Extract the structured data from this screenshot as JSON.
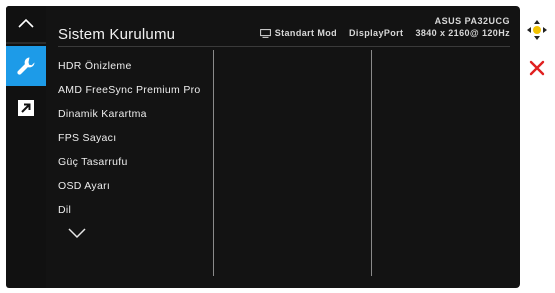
{
  "panel": {
    "title": "Sistem Kurulumu",
    "model": "ASUS PA32UCG",
    "mode": "Standart Mod",
    "input": "DisplayPort",
    "resolution": "3840 x 2160@  120Hz"
  },
  "menu": {
    "items": [
      "HDR Önizleme",
      "AMD FreeSync Premium Pro",
      "Dinamik Karartma",
      "FPS Sayacı",
      "Güç Tasarrufu",
      "OSD Ayarı",
      "Dil"
    ]
  },
  "icons": {
    "nav_up": "chevron-up-icon",
    "nav_system": "wrench-icon",
    "nav_shortcut": "arrow-up-right-icon",
    "more": "chevron-down-icon",
    "joystick": "joystick-icon",
    "exit": "close-icon",
    "monitor": "monitor-icon"
  },
  "colors": {
    "accent": "#1d9be8",
    "panel_bg": "#131313",
    "exit_red": "#e02020",
    "joystick_yellow": "#f2c200"
  }
}
